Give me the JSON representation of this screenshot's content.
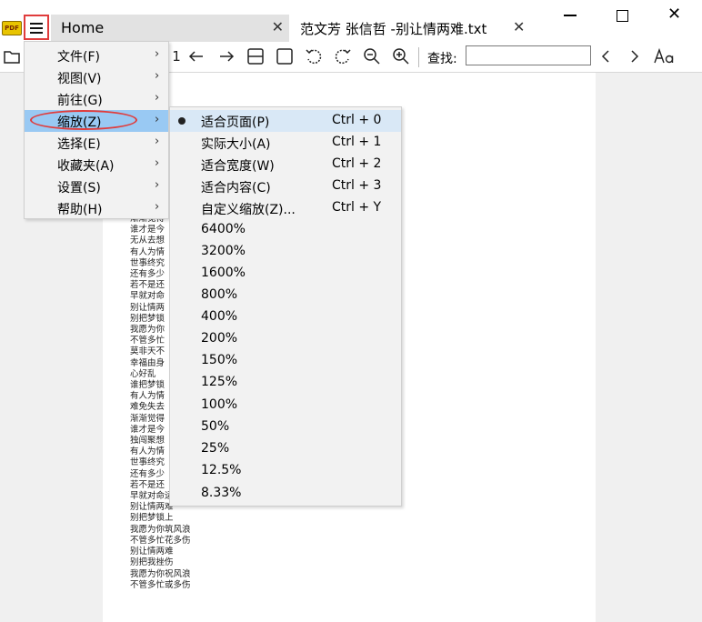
{
  "app": {
    "logo_text": "PDF"
  },
  "tabs": [
    {
      "label": "Home",
      "close": "✕"
    },
    {
      "label": "范文芳  张信哲  -别让情两难.txt",
      "close": "✕"
    }
  ],
  "window": {
    "close": "✕"
  },
  "toolbar": {
    "page_number": "1",
    "search_label": "查找:",
    "search_value": ""
  },
  "main_menu": {
    "items": [
      {
        "label": "文件(F)",
        "arrow": "›"
      },
      {
        "label": "视图(V)",
        "arrow": "›"
      },
      {
        "label": "前往(G)",
        "arrow": "›"
      },
      {
        "label": "缩放(Z)",
        "arrow": "›"
      },
      {
        "label": "选择(E)",
        "arrow": "›"
      },
      {
        "label": "收藏夹(A)",
        "arrow": "›"
      },
      {
        "label": "设置(S)",
        "arrow": "›"
      },
      {
        "label": "帮助(H)",
        "arrow": "›"
      }
    ]
  },
  "zoom_menu": {
    "items": [
      {
        "label": "适合页面(P)",
        "shortcut": "Ctrl + 0"
      },
      {
        "label": "实际大小(A)",
        "shortcut": "Ctrl + 1"
      },
      {
        "label": "适合宽度(W)",
        "shortcut": "Ctrl + 2"
      },
      {
        "label": "适合内容(C)",
        "shortcut": "Ctrl + 3"
      },
      {
        "label": "自定义缩放(Z)...",
        "shortcut": "Ctrl + Y"
      },
      {
        "label": "6400%",
        "shortcut": ""
      },
      {
        "label": "3200%",
        "shortcut": ""
      },
      {
        "label": "1600%",
        "shortcut": ""
      },
      {
        "label": "800%",
        "shortcut": ""
      },
      {
        "label": "400%",
        "shortcut": ""
      },
      {
        "label": "200%",
        "shortcut": ""
      },
      {
        "label": "150%",
        "shortcut": ""
      },
      {
        "label": "125%",
        "shortcut": ""
      },
      {
        "label": "100%",
        "shortcut": ""
      },
      {
        "label": "50%",
        "shortcut": ""
      },
      {
        "label": "25%",
        "shortcut": ""
      },
      {
        "label": "12.5%",
        "shortcut": ""
      },
      {
        "label": "8.33%",
        "shortcut": ""
      }
    ]
  },
  "document": {
    "lines": [
      "渐渐觉得",
      "谁才是今",
      "无从去想",
      "有人为情",
      "世事终究",
      "还有多少",
      "若不是还",
      "早就对命",
      "别让情两",
      "别把梦锁",
      "我愿为你",
      "不管多忙",
      "莫非天不",
      "幸福由身",
      "心好乱",
      "谁把梦锁",
      "有人为情",
      "难免失去",
      "渐渐觉得",
      "谁才是今",
      "独闯聚想",
      "有人为情",
      "世事终究",
      "还有多少",
      "若不是还",
      "早就对命运投降",
      "别让情两难",
      "别把梦锁上",
      "我愿为你筑风浪",
      "不管多忙花多伤",
      "别让情两难",
      "别把我挫伤",
      "我愿为你祝风浪",
      "不管多忙或多伤"
    ]
  }
}
